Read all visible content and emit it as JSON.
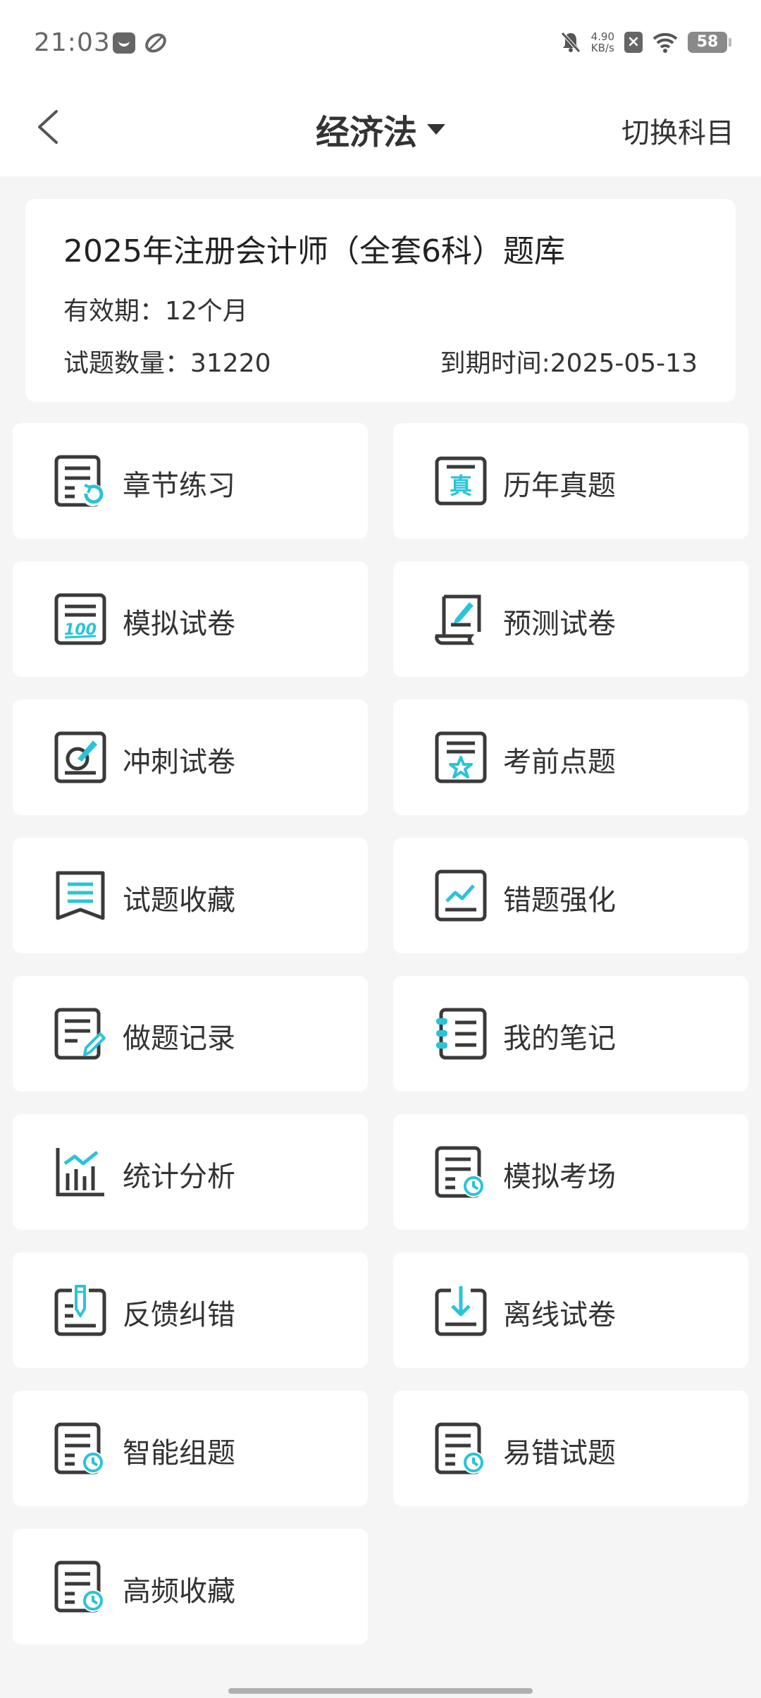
{
  "status_bar": {
    "time": "21:03",
    "net_speed_value": "4.90",
    "net_speed_unit": "KB/s",
    "battery": "58"
  },
  "header": {
    "subject": "经济法",
    "switch_label": "切换科目"
  },
  "info": {
    "title": "2025年注册会计师（全套6科）题库",
    "validity": "有效期：12个月",
    "question_count": "试题数量：31220",
    "expire": "到期时间:2025-05-13"
  },
  "menu": [
    {
      "label": "章节练习",
      "icon": "chapter-practice-icon"
    },
    {
      "label": "历年真题",
      "icon": "past-exams-icon"
    },
    {
      "label": "模拟试卷",
      "icon": "mock-paper-icon"
    },
    {
      "label": "预测试卷",
      "icon": "forecast-paper-icon"
    },
    {
      "label": "冲刺试卷",
      "icon": "sprint-paper-icon"
    },
    {
      "label": "考前点题",
      "icon": "pre-exam-star-icon"
    },
    {
      "label": "试题收藏",
      "icon": "bookmark-icon"
    },
    {
      "label": "错题强化",
      "icon": "trend-chart-icon"
    },
    {
      "label": "做题记录",
      "icon": "record-pencil-icon"
    },
    {
      "label": "我的笔记",
      "icon": "notebook-icon"
    },
    {
      "label": "统计分析",
      "icon": "bar-chart-icon"
    },
    {
      "label": "模拟考场",
      "icon": "doc-clock-icon"
    },
    {
      "label": "反馈纠错",
      "icon": "feedback-pen-icon"
    },
    {
      "label": "离线试卷",
      "icon": "download-icon"
    },
    {
      "label": "智能组题",
      "icon": "doc-clock-icon"
    },
    {
      "label": "易错试题",
      "icon": "doc-clock-icon"
    },
    {
      "label": "高频收藏",
      "icon": "doc-clock-icon"
    }
  ],
  "colors": {
    "accent": "#29c4d8",
    "icon_dark": "#3a3a3a",
    "background": "#f5f5f5"
  }
}
